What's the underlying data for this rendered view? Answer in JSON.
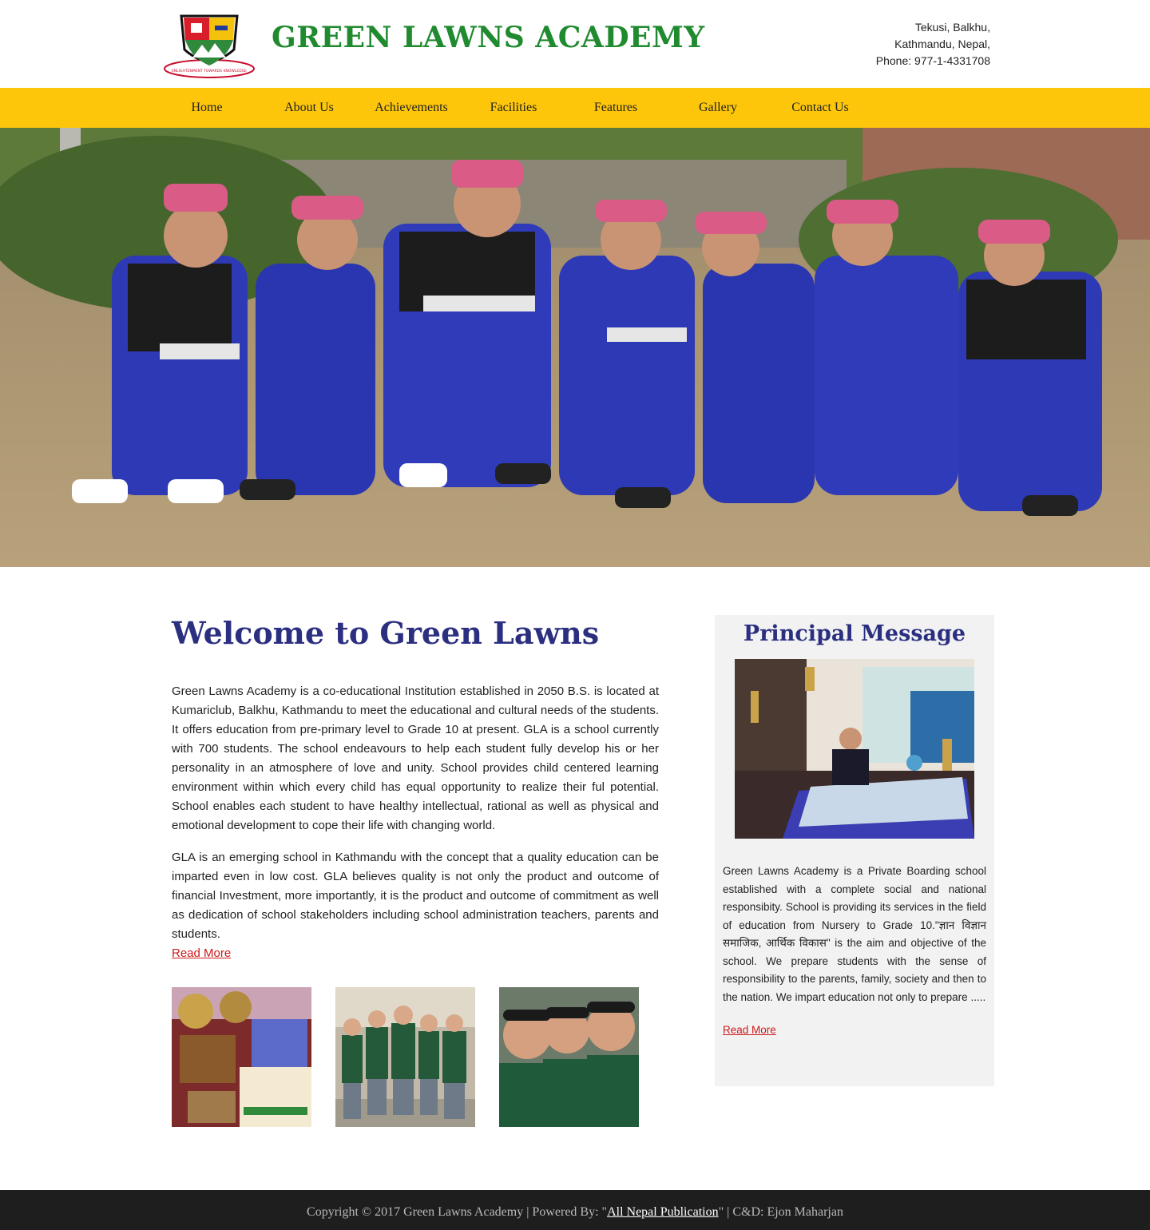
{
  "header": {
    "site_title": "GREEN LAWNS ACADEMY",
    "address_line_1": "Tekusi, Balkhu,",
    "address_line_2": "Kathmandu, Nepal,",
    "phone_line": "Phone: 977-1-4331708",
    "logo_icon": "school-crest-icon",
    "logo_text": "ENLIGHTENMENT TOWARDS KNOWLEDGE"
  },
  "nav": {
    "items": [
      {
        "label": "Home"
      },
      {
        "label": "About Us"
      },
      {
        "label": "Achievements"
      },
      {
        "label": "Facilities"
      },
      {
        "label": "Features"
      },
      {
        "label": "Gallery"
      },
      {
        "label": "Contact Us"
      }
    ]
  },
  "welcome": {
    "title": "Welcome to Green Lawns",
    "paragraph_1": "Green Lawns Academy is a co-educational Institution established in 2050 B.S. is located at Kumariclub, Balkhu, Kathmandu to meet the educational and cultural needs of the students. It offers education from pre-primary level to Grade 10 at present. GLA is a school currently with 700 students. The school endeavours to help each student fully develop his or her personality in an atmosphere of love and unity. School provides child centered learning environment within which every child has equal opportunity to realize their ful potential. School enables each student to have healthy intellectual, rational as well as physical and emotional development to cope their life with changing world.",
    "paragraph_2": "GLA is an emerging school in Kathmandu with the concept that a quality education can be imparted even in low cost. GLA believes quality is not only the product and outcome of financial Investment, more importantly, it is the product and outcome of commitment as well as dedication of school stakeholders including school administration teachers, parents and students.",
    "read_more": "Read More"
  },
  "principal": {
    "title": "Principal Message",
    "text": "Green Lawns Academy is a Private Boarding school established with a complete social and national responsibity. School is providing its services in the field of education from Nursery to Grade 10.\"ज्ञान विज्ञान समाजिक, आर्थिक विकास\" is the aim and objective of the school. We prepare students with the sense of responsibility to the parents, family, society and then to the nation. We impart education not only to prepare .....",
    "read_more": "Read More"
  },
  "footer": {
    "prefix": "Copyright © 2017 Green Lawns Academy | Powered By: \"",
    "link_text": "All Nepal Publication",
    "suffix": "\" | C&D: Ejon Maharjan"
  },
  "colors": {
    "brand_green": "#1f8a2e",
    "nav_yellow": "#fdc60a",
    "heading_blue": "#2b2f80",
    "link_red": "#cc1a1a",
    "footer_bg": "#1e1e1e"
  }
}
